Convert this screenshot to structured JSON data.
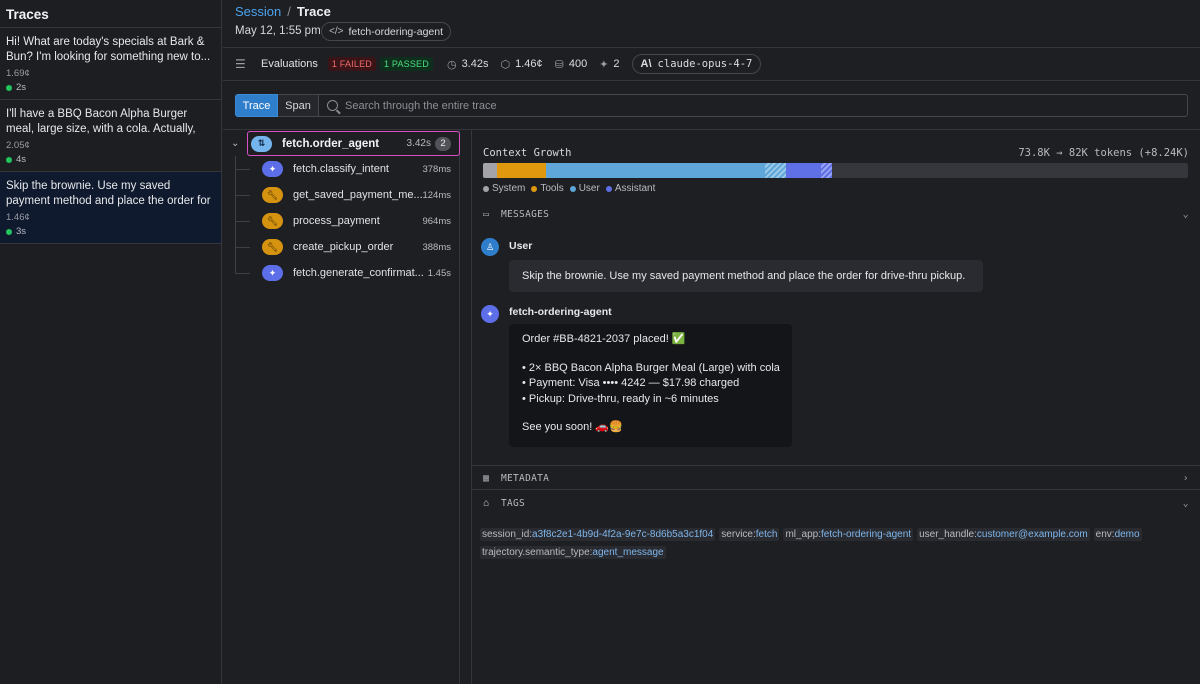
{
  "traces": {
    "title": "Traces",
    "items": [
      {
        "text": "Hi! What are today's specials at Bark & Bun? I'm looking for something new to...",
        "cost": "1.69¢",
        "duration": "2s"
      },
      {
        "text": "I'll have a BBQ Bacon Alpha Burger meal, large size, with a cola. Actually, make tha...",
        "cost": "2.05¢",
        "duration": "4s"
      },
      {
        "text": "Skip the brownie. Use my saved payment method and place the order for drive-thr...",
        "cost": "1.46¢",
        "duration": "3s"
      }
    ]
  },
  "header": {
    "crumb_session": "Session",
    "crumb_sep": "/",
    "crumb_trace": "Trace",
    "date": "May 12, 1:55 pm",
    "agent_chip": "fetch-ordering-agent",
    "agent_chip_icon": "</>"
  },
  "evaluations": {
    "label": "Evaluations",
    "failed": "1 FAILED",
    "passed": "1 PASSED",
    "duration": "3.42s",
    "cost": "1.46¢",
    "tokens": "400",
    "spans": "2",
    "model": "claude-opus-4-7",
    "model_logo": "A\\"
  },
  "toolbar": {
    "tab_trace": "Trace",
    "tab_span": "Span",
    "search_placeholder": "Search through the entire trace"
  },
  "tree": {
    "root": {
      "name": "fetch.order_agent",
      "duration": "3.42s",
      "count": "2",
      "icon": "agent-icon"
    },
    "children": [
      {
        "name": "fetch.classify_intent",
        "duration": "378ms",
        "kind": "llm"
      },
      {
        "name": "get_saved_payment_me...",
        "duration": "124ms",
        "kind": "tool"
      },
      {
        "name": "process_payment",
        "duration": "964ms",
        "kind": "tool"
      },
      {
        "name": "create_pickup_order",
        "duration": "388ms",
        "kind": "tool"
      },
      {
        "name": "fetch.generate_confirmat...",
        "duration": "1.45s",
        "kind": "llm"
      }
    ]
  },
  "context": {
    "title": "Context Growth",
    "tokens": "73.8K → 82K tokens (+8.24K)",
    "segments": [
      {
        "type": "system",
        "fraction": 0.02
      },
      {
        "type": "tools",
        "fraction": 0.07
      },
      {
        "type": "user",
        "fraction": 0.31
      },
      {
        "type": "user-added",
        "fraction": 0.03
      },
      {
        "type": "assistant",
        "fraction": 0.05
      },
      {
        "type": "assistant-added",
        "fraction": 0.015
      }
    ],
    "legend": [
      "System",
      "Tools",
      "User",
      "Assistant"
    ],
    "colors": {
      "system": "#a3a3a8",
      "tools": "#e0990f",
      "user": "#5ea7d8",
      "assistant": "#5f6fe6"
    }
  },
  "messages": {
    "section_label": "MESSAGES",
    "user_sender": "User",
    "user_text": "Skip the brownie. Use my saved payment method and place the order for drive-thru pickup.",
    "agent_sender": "fetch-ordering-agent",
    "agent_lines": [
      "Order #BB-4821-2037 placed! ✅",
      "• 2× BBQ Bacon Alpha Burger Meal (Large) with cola",
      "• Payment: Visa •••• 4242 — $17.98 charged",
      "• Pickup: Drive-thru, ready in ~6 minutes",
      "See you soon! 🚗🍔"
    ]
  },
  "metadata": {
    "section_label": "METADATA"
  },
  "tags": {
    "section_label": "TAGS",
    "items": [
      {
        "key": "session_id:",
        "value": "a3f8c2e1-4b9d-4f2a-9e7c-8d6b5a3c1f04"
      },
      {
        "key": "service:",
        "value": "fetch"
      },
      {
        "key": "ml_app:",
        "value": "fetch-ordering-agent"
      },
      {
        "key": "user_handle:",
        "value": "customer@example.com"
      },
      {
        "key": "env:",
        "value": "demo"
      },
      {
        "key": "trajectory.semantic_type:",
        "value": "agent_message"
      }
    ]
  }
}
